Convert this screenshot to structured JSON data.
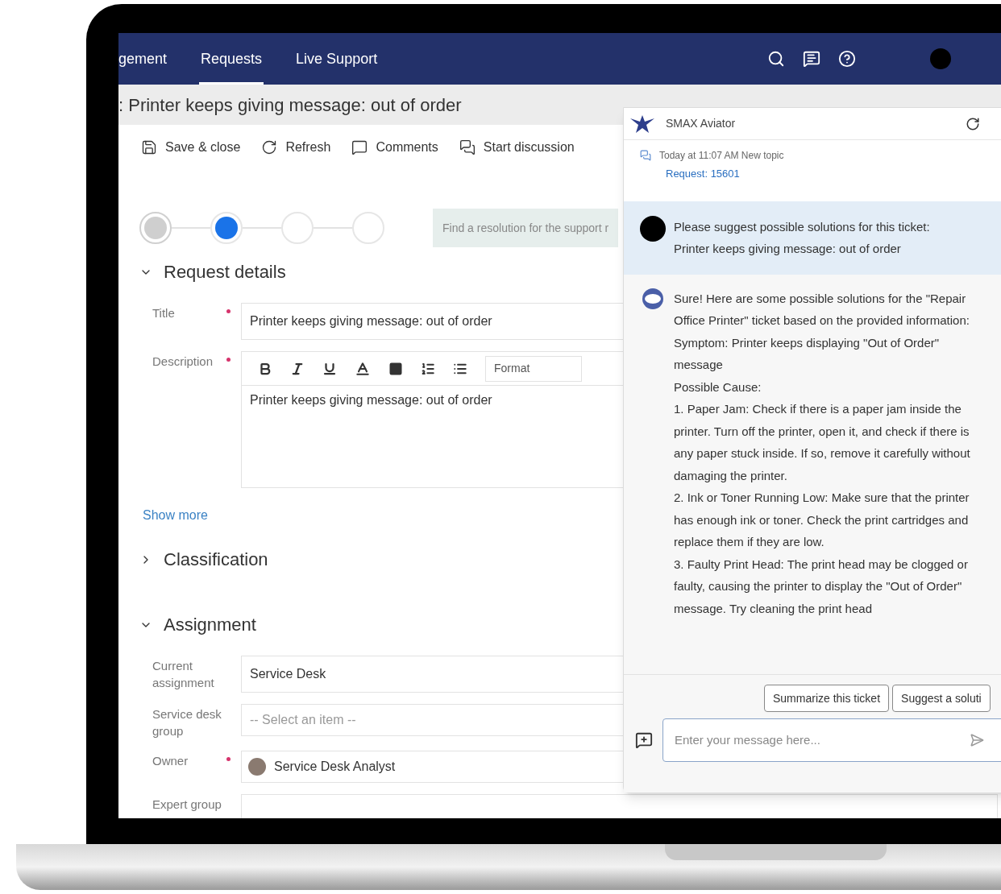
{
  "nav": {
    "tabs": [
      {
        "label": "gement",
        "selected": false
      },
      {
        "label": "Requests",
        "selected": true
      },
      {
        "label": "Live Support",
        "selected": false
      }
    ]
  },
  "record_title": ": Printer keeps giving message: out of order",
  "toolbar": [
    {
      "kind": "save",
      "label": "Save & close"
    },
    {
      "kind": "refresh",
      "label": "Refresh"
    },
    {
      "kind": "comments",
      "label": "Comments"
    },
    {
      "kind": "discussion",
      "label": "Start discussion"
    }
  ],
  "stepper": {
    "steps": [
      {
        "completed": true,
        "selected": false
      },
      {
        "completed": false,
        "selected": true
      },
      {
        "completed": false,
        "selected": false
      },
      {
        "completed": false,
        "selected": false
      }
    ],
    "hint": "Find a resolution for the support r"
  },
  "sections": [
    {
      "title": "Request details",
      "expanded": true,
      "fields": [
        {
          "kind": "text",
          "label": "Title",
          "required": true,
          "value": "Printer keeps giving message: out of order"
        },
        {
          "kind": "richtext",
          "label": "Description",
          "required": true,
          "format": "Format",
          "value": "Printer keeps giving message: out of order"
        }
      ],
      "link": "Show more"
    },
    {
      "title": "Classification",
      "expanded": false
    },
    {
      "title": "Assignment",
      "expanded": true,
      "fields": [
        {
          "kind": "text",
          "label": "Current assignment",
          "required": false,
          "value": "Service Desk"
        },
        {
          "kind": "select",
          "label": "Service desk group",
          "required": false,
          "placeholder": "-- Select an item --"
        },
        {
          "kind": "person",
          "label": "Owner",
          "required": true,
          "value": "Service Desk Analyst"
        },
        {
          "kind": "empty",
          "label": "Expert group",
          "required": false
        }
      ]
    }
  ],
  "chat": {
    "title": "SMAX Aviator",
    "topic": "Today at 11:07 AM New topic",
    "request_link": "Request: 15601",
    "messages": [
      {
        "kind": "user",
        "lines": [
          "Please suggest possible solutions for this ticket:",
          "Printer keeps giving message: out of order"
        ]
      },
      {
        "kind": "bot",
        "lines": [
          "Sure! Here are some possible solutions for the \"Repair Office Printer\" ticket based on the provided information:",
          "Symptom: Printer keeps displaying \"Out of Order\" message",
          "Possible Cause:",
          "1. Paper Jam: Check if there is a paper jam inside the printer. Turn off the printer, open it, and check if there is any paper stuck inside. If so, remove it carefully without damaging the printer.",
          "2. Ink or Toner Running Low: Make sure that the printer has enough ink or toner. Check the print cartridges and replace them if they are low.",
          "3. Faulty Print Head: The print head may be clogged or faulty, causing the printer to display the \"Out of Order\" message. Try cleaning the print head"
        ]
      }
    ],
    "suggestions": [
      "Summarize this ticket",
      "Suggest a soluti"
    ],
    "input": {
      "placeholder": "Enter your message here..."
    }
  }
}
